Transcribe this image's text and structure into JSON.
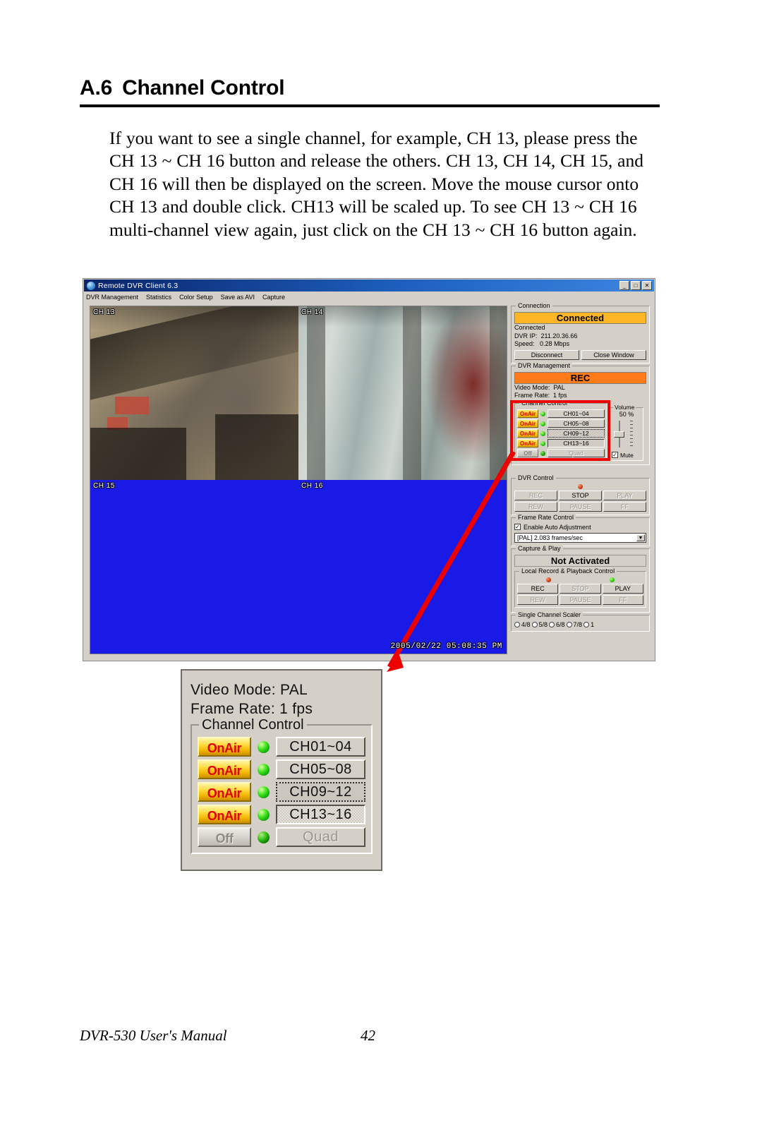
{
  "document": {
    "heading_number": "A.6",
    "heading_title": "Channel Control",
    "paragraph": "If you want to see a single channel, for example, CH 13, please press the CH 13 ~ CH 16 button and release the others. CH 13, CH 14, CH 15, and CH 16 will then be displayed on the screen. Move the mouse cursor onto CH 13 and double click. CH13 will be scaled up. To see CH 13 ~ CH 16 multi-channel view again, just click on the CH 13 ~ CH 16 button again.",
    "footer_text": "DVR-530 User's Manual",
    "page_number": "42"
  },
  "app_window": {
    "title": "Remote DVR Client 6.3",
    "title_icon": "app-globe-icon",
    "window_buttons": [
      {
        "name": "minimize",
        "glyph": "_"
      },
      {
        "name": "maximize",
        "glyph": "□"
      },
      {
        "name": "close",
        "glyph": "✕"
      }
    ],
    "menu": [
      "DVR Management",
      "Statistics",
      "Color Setup",
      "Save as AVI",
      "Capture"
    ],
    "video": {
      "cells": [
        {
          "label": "CH 13",
          "state": "live"
        },
        {
          "label": "CH 14",
          "state": "live"
        },
        {
          "label": "CH 15",
          "state": "blue"
        },
        {
          "label": "CH 16",
          "state": "blue"
        }
      ],
      "timestamp": "2005/02/22 05:08:35 PM",
      "no_signal_color": "#1a1ae6"
    },
    "connection": {
      "legend": "Connection",
      "status_banner": "Connected",
      "status_color": "#ffb626",
      "status_line": "Connected",
      "ip_label": "DVR IP:",
      "ip_value": "211.20.36.66",
      "speed_label": "Speed:",
      "speed_value": "0.28 Mbps",
      "disconnect_button": "Disconnect",
      "close_window_button": "Close Window"
    },
    "dvr_management": {
      "legend": "DVR Management",
      "status_banner": "REC",
      "status_color": "#ff7a18",
      "video_mode_label": "Video Mode:",
      "video_mode_value": "PAL",
      "frame_rate_label": "Frame Rate:",
      "frame_rate_value": "1 fps"
    },
    "channel_control": {
      "legend": "Channel Control",
      "highlight_color": "#ee0000",
      "rows": [
        {
          "air": "OnAir",
          "air_state": "on",
          "led": "on",
          "button": "CH01~04",
          "button_state": "normal"
        },
        {
          "air": "OnAir",
          "air_state": "on",
          "led": "on",
          "button": "CH05~08",
          "button_state": "normal"
        },
        {
          "air": "OnAir",
          "air_state": "on",
          "led": "on",
          "button": "CH09~12",
          "button_state": "focused"
        },
        {
          "air": "OnAir",
          "air_state": "on",
          "led": "on",
          "button": "CH13~16",
          "button_state": "pressed"
        },
        {
          "air": "Off",
          "air_state": "off",
          "led": "dim",
          "button": "Quad",
          "button_state": "disabled"
        }
      ]
    },
    "volume": {
      "legend": "Volume",
      "value": "50 %",
      "mute_label": "Mute",
      "mute_checked": true,
      "mute_glyph": "✓"
    },
    "dvr_control": {
      "legend": "DVR Control",
      "led": "red",
      "buttons": [
        {
          "label": "REC",
          "enabled": false
        },
        {
          "label": "STOP",
          "enabled": true
        },
        {
          "label": "PLAY",
          "enabled": false
        },
        {
          "label": "REW",
          "enabled": false
        },
        {
          "label": "PAUSE",
          "enabled": false
        },
        {
          "label": "FF",
          "enabled": false
        }
      ]
    },
    "frame_rate_control": {
      "legend": "Frame Rate Control",
      "checkbox_label": "Enable Auto Adjustment",
      "checkbox_checked": true,
      "checkbox_glyph": "✓",
      "combo_value": "[PAL] 2.083 frames/sec",
      "combo_arrow": "▼"
    },
    "capture_play": {
      "legend": "Capture & Play",
      "status_banner": "Not Activated"
    },
    "local_record": {
      "legend": "Local Record & Playback Control",
      "led_left": "red",
      "led_right": "green",
      "buttons": [
        {
          "label": "REC",
          "enabled": true
        },
        {
          "label": "STOP",
          "enabled": false
        },
        {
          "label": "PLAY",
          "enabled": true
        },
        {
          "label": "REW",
          "enabled": false
        },
        {
          "label": "PAUSE",
          "enabled": false
        },
        {
          "label": "FF",
          "enabled": false
        }
      ]
    },
    "single_channel_scaler": {
      "legend": "Single Channel Scaler",
      "options": [
        "4/8",
        "5/8",
        "6/8",
        "7/8",
        "1"
      ],
      "selected": ""
    }
  },
  "zoom_callout": {
    "video_mode_label": "Video Mode:",
    "video_mode_value": "PAL",
    "frame_rate_label": "Frame Rate:",
    "frame_rate_value": "1 fps",
    "legend": "Channel Control",
    "rows": [
      {
        "air": "OnAir",
        "air_state": "on",
        "led": "on",
        "button": "CH01~04",
        "button_state": "normal"
      },
      {
        "air": "OnAir",
        "air_state": "on",
        "led": "on",
        "button": "CH05~08",
        "button_state": "normal"
      },
      {
        "air": "OnAir",
        "air_state": "on",
        "led": "on",
        "button": "CH09~12",
        "button_state": "focused"
      },
      {
        "air": "OnAir",
        "air_state": "on",
        "led": "on",
        "button": "CH13~16",
        "button_state": "pressed"
      },
      {
        "air": "Off",
        "air_state": "off",
        "led": "dim",
        "button": "Quad",
        "button_state": "disabled"
      }
    ]
  }
}
